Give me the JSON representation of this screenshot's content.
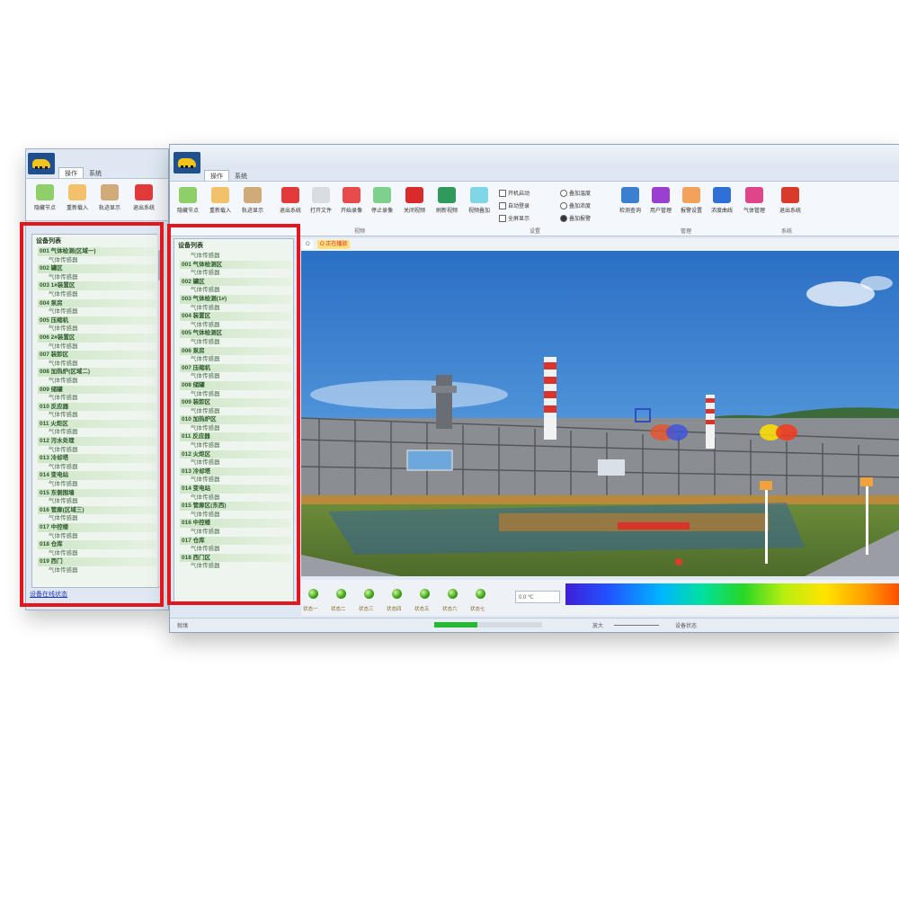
{
  "colors": {
    "highlight": "#e3161f",
    "accent": "#1f4f8f",
    "tree_group": "#cfe6c8",
    "led": "#3aa012",
    "progress": "#26b832"
  },
  "back_window": {
    "tabs": [
      "操作",
      "系统"
    ],
    "ribbon": [
      {
        "label": "隐藏节点",
        "icon": "green-square-icon",
        "color": "#8fcf6a"
      },
      {
        "label": "重新载入",
        "icon": "orange-square-icon",
        "color": "#f2c26a"
      },
      {
        "label": "轨迹显示",
        "icon": "tan-square-icon",
        "color": "#cfab7a"
      },
      {
        "label": "退出系统",
        "icon": "close-icon",
        "color": "#e23a3a"
      }
    ],
    "tree_root": "设备列表",
    "tree": [
      {
        "t": "g",
        "text": "001 气体检测(区域一)"
      },
      {
        "t": "c",
        "text": "气体传感器"
      },
      {
        "t": "g",
        "text": "002 罐区"
      },
      {
        "t": "c",
        "text": "气体传感器"
      },
      {
        "t": "g",
        "text": "003 1#装置区"
      },
      {
        "t": "c",
        "text": "气体传感器"
      },
      {
        "t": "g",
        "text": "004 泵房"
      },
      {
        "t": "c",
        "text": "气体传感器"
      },
      {
        "t": "g",
        "text": "005 压缩机"
      },
      {
        "t": "c",
        "text": "气体传感器"
      },
      {
        "t": "g",
        "text": "006 2#装置区"
      },
      {
        "t": "c",
        "text": "气体传感器"
      },
      {
        "t": "g",
        "text": "007 装卸区"
      },
      {
        "t": "c",
        "text": "气体传感器"
      },
      {
        "t": "g",
        "text": "008 加热炉(区域二)"
      },
      {
        "t": "c",
        "text": "气体传感器"
      },
      {
        "t": "g",
        "text": "009 储罐"
      },
      {
        "t": "c",
        "text": "气体传感器"
      },
      {
        "t": "g",
        "text": "010 反应器"
      },
      {
        "t": "c",
        "text": "气体传感器"
      },
      {
        "t": "g",
        "text": "011 火炬区"
      },
      {
        "t": "c",
        "text": "气体传感器"
      },
      {
        "t": "g",
        "text": "012 污水处理"
      },
      {
        "t": "c",
        "text": "气体传感器"
      },
      {
        "t": "g",
        "text": "013 冷却塔"
      },
      {
        "t": "c",
        "text": "气体传感器"
      },
      {
        "t": "g",
        "text": "014 变电站"
      },
      {
        "t": "c",
        "text": "气体传感器"
      },
      {
        "t": "g",
        "text": "015 东侧围墙"
      },
      {
        "t": "c",
        "text": "气体传感器"
      },
      {
        "t": "g",
        "text": "016 管廊(区域三)"
      },
      {
        "t": "c",
        "text": "气体传感器"
      },
      {
        "t": "g",
        "text": "017 中控楼"
      },
      {
        "t": "c",
        "text": "气体传感器"
      },
      {
        "t": "g",
        "text": "018 仓库"
      },
      {
        "t": "c",
        "text": "气体传感器"
      },
      {
        "t": "g",
        "text": "019 西门"
      },
      {
        "t": "c",
        "text": "气体传感器"
      }
    ],
    "footer_link": "设备在线状态"
  },
  "main_window": {
    "tabs": [
      "操作",
      "系统"
    ],
    "ribbon": [
      {
        "label": "隐藏节点",
        "icon": "green-square-icon",
        "color": "#8fcf6a"
      },
      {
        "label": "重新载入",
        "icon": "orange-square-icon",
        "color": "#f2c26a"
      },
      {
        "label": "轨迹显示",
        "icon": "tan-square-icon",
        "color": "#cfab7a"
      },
      {
        "label": "退出系统",
        "icon": "close-icon",
        "color": "#e23a3a"
      },
      {
        "label": "打开文件",
        "icon": "folder-icon",
        "color": "#d9dde2"
      },
      {
        "label": "开始录像",
        "icon": "record-icon",
        "color": "#e84b4b"
      },
      {
        "label": "停止录像",
        "icon": "green-arrow-icon",
        "color": "#7fd08c"
      },
      {
        "label": "关闭视频",
        "icon": "power-icon",
        "color": "#d92b2b"
      },
      {
        "label": "刷新视频",
        "icon": "refresh-icon",
        "color": "#2f9a5a"
      },
      {
        "label": "视频叠加",
        "icon": "overlay-icon",
        "color": "#7fd6e6"
      },
      {
        "label": "检测查询",
        "icon": "search-icon",
        "color": "#3b7fd0"
      },
      {
        "label": "用户管理",
        "icon": "user-icon",
        "color": "#9a3fd0"
      },
      {
        "label": "报警设置",
        "icon": "alarm-icon",
        "color": "#f2a25a"
      },
      {
        "label": "浓度曲线",
        "icon": "wave-icon",
        "color": "#2f6fd6"
      },
      {
        "label": "气体管理",
        "icon": "gas-icon",
        "color": "#e0458a"
      },
      {
        "label": "退出系统",
        "icon": "exit-icon",
        "color": "#d93a2a"
      }
    ],
    "options_left": [
      {
        "label": "开机启动",
        "checked": false
      },
      {
        "label": "自动登录",
        "checked": false
      },
      {
        "label": "全屏显示",
        "checked": false
      }
    ],
    "options_right": [
      {
        "label": "叠加温度",
        "selected": false
      },
      {
        "label": "叠加浓度",
        "selected": false
      },
      {
        "label": "叠加报警",
        "selected": true
      }
    ],
    "group_labels": [
      "视频",
      "设置",
      "管理",
      "系统"
    ],
    "tree_root": "设备列表",
    "tree": [
      {
        "t": "c",
        "text": "气体传感器"
      },
      {
        "t": "g",
        "text": "001 气体检测区"
      },
      {
        "t": "c",
        "text": "气体传感器"
      },
      {
        "t": "g",
        "text": "002 罐区"
      },
      {
        "t": "c",
        "text": "气体传感器"
      },
      {
        "t": "g",
        "text": "003 气体检测(1#)"
      },
      {
        "t": "c",
        "text": "气体传感器"
      },
      {
        "t": "g",
        "text": "004 装置区"
      },
      {
        "t": "c",
        "text": "气体传感器"
      },
      {
        "t": "g",
        "text": "005 气体检测区"
      },
      {
        "t": "c",
        "text": "气体传感器"
      },
      {
        "t": "g",
        "text": "006 泵房"
      },
      {
        "t": "c",
        "text": "气体传感器"
      },
      {
        "t": "g",
        "text": "007 压缩机"
      },
      {
        "t": "c",
        "text": "气体传感器"
      },
      {
        "t": "g",
        "text": "008 储罐"
      },
      {
        "t": "c",
        "text": "气体传感器"
      },
      {
        "t": "g",
        "text": "009 装卸区"
      },
      {
        "t": "c",
        "text": "气体传感器"
      },
      {
        "t": "g",
        "text": "010 加热炉区"
      },
      {
        "t": "c",
        "text": "气体传感器"
      },
      {
        "t": "g",
        "text": "011 反应器"
      },
      {
        "t": "c",
        "text": "气体传感器"
      },
      {
        "t": "g",
        "text": "012 火炬区"
      },
      {
        "t": "c",
        "text": "气体传感器"
      },
      {
        "t": "g",
        "text": "013 冷却塔"
      },
      {
        "t": "c",
        "text": "气体传感器"
      },
      {
        "t": "g",
        "text": "014 变电站"
      },
      {
        "t": "c",
        "text": "气体传感器"
      },
      {
        "t": "g",
        "text": "015 管廊区(东西)"
      },
      {
        "t": "c",
        "text": "气体传感器"
      },
      {
        "t": "g",
        "text": "016 中控楼"
      },
      {
        "t": "c",
        "text": "气体传感器"
      },
      {
        "t": "g",
        "text": "017 仓库"
      },
      {
        "t": "c",
        "text": "气体传感器"
      },
      {
        "t": "g",
        "text": "018 西门区"
      },
      {
        "t": "c",
        "text": "气体传感器"
      }
    ],
    "video_toolbar": [
      {
        "label": "O",
        "color": "#2f6fd6",
        "bg": "#ffffff"
      },
      {
        "label": "O 正在播放",
        "color": "#d92b2b",
        "bg": "#ffe07a"
      }
    ],
    "leds": [
      {
        "label": "状态一"
      },
      {
        "label": "状态二"
      },
      {
        "label": "状态三"
      },
      {
        "label": "状态四"
      },
      {
        "label": "状态五"
      },
      {
        "label": "状态六"
      },
      {
        "label": "状态七"
      }
    ],
    "status_field": "0.0 ℃",
    "bottom": {
      "left_text": "就绪",
      "progress": 0.4,
      "zoom_text": "放大",
      "right_text": "设备状态"
    }
  }
}
